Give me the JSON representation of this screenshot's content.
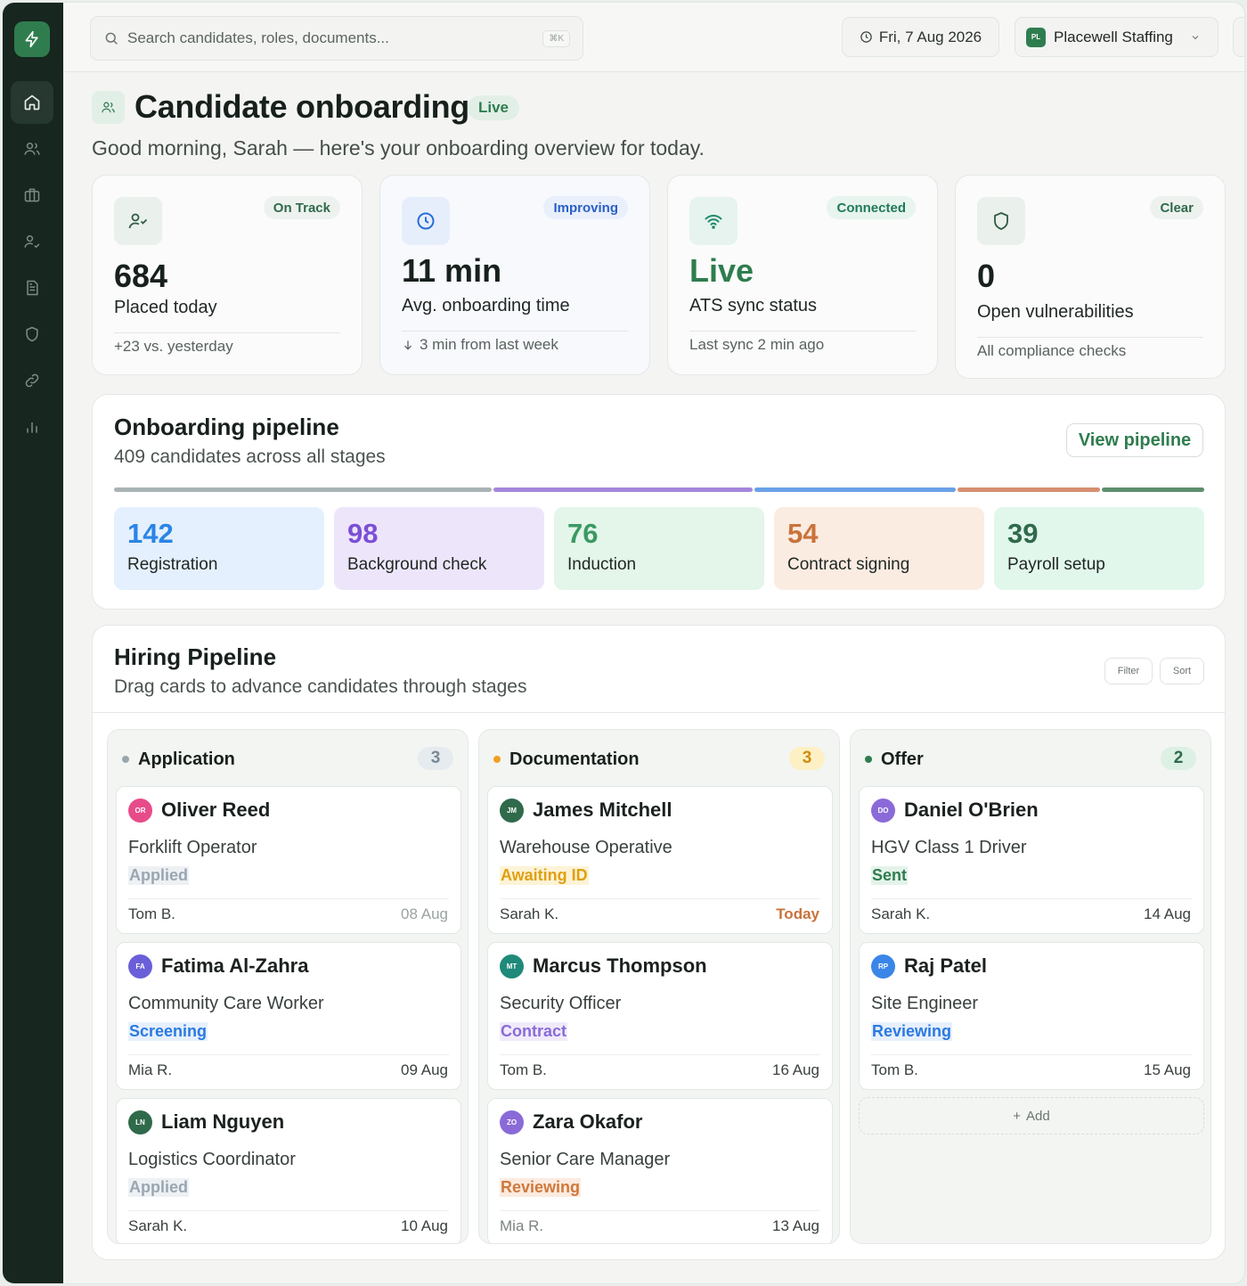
{
  "search": {
    "placeholder": "Search candidates, roles, documents...",
    "shortcut": "⌘K"
  },
  "topbar": {
    "date": "Fri, 7 Aug 2026",
    "org_initials": "PL",
    "org_name": "Placewell Staffing"
  },
  "header": {
    "title": "Candidate onboarding",
    "status_badge": "Live",
    "greeting": "Good morning, Sarah — here's your onboarding overview for today."
  },
  "stats": [
    {
      "badge": "On Track",
      "value": "684",
      "label": "Placed today",
      "foot": "+23 vs. yesterday",
      "icon": "user-check-icon"
    },
    {
      "badge": "Improving",
      "value": "11 min",
      "label": "Avg. onboarding time",
      "foot": "3 min from last week",
      "icon": "clock-icon"
    },
    {
      "badge": "Connected",
      "value": "Live",
      "label": "ATS sync status",
      "foot": "Last sync 2 min ago",
      "icon": "wifi-icon"
    },
    {
      "badge": "Clear",
      "value": "0",
      "label": "Open vulnerabilities",
      "foot": "All compliance checks",
      "icon": "shield-icon"
    }
  ],
  "onboarding_pipeline": {
    "title": "Onboarding pipeline",
    "subtitle": "409 candidates across all stages",
    "view_button": "View pipeline",
    "stages": [
      {
        "count": "142",
        "label": "Registration",
        "color": "#2a85e6"
      },
      {
        "count": "98",
        "label": "Background check",
        "color": "#7b4fd6"
      },
      {
        "count": "76",
        "label": "Induction",
        "color": "#3a9a63"
      },
      {
        "count": "54",
        "label": "Contract signing",
        "color": "#c9733a"
      },
      {
        "count": "39",
        "label": "Payroll setup",
        "color": "#2f6a4a"
      }
    ]
  },
  "hiring_pipeline": {
    "title": "Hiring Pipeline",
    "subtitle": "Drag cards to advance candidates through stages",
    "filter_button": "Filter",
    "sort_button": "Sort",
    "add_label": "Add",
    "columns": [
      {
        "title": "Application",
        "count": "3",
        "cards": [
          {
            "initials": "OR",
            "name": "Oliver Reed",
            "role": "Forklift Operator",
            "status": "Applied",
            "owner": "Tom B.",
            "date": "08 Aug"
          },
          {
            "initials": "FA",
            "name": "Fatima Al-Zahra",
            "role": "Community Care Worker",
            "status": "Screening",
            "owner": "Mia R.",
            "date": "09 Aug"
          },
          {
            "initials": "LN",
            "name": "Liam Nguyen",
            "role": "Logistics Coordinator",
            "status": "Applied",
            "owner": "Sarah K.",
            "date": "10 Aug"
          }
        ]
      },
      {
        "title": "Documentation",
        "count": "3",
        "cards": [
          {
            "initials": "JM",
            "name": "James Mitchell",
            "role": "Warehouse Operative",
            "status": "Awaiting ID",
            "owner": "Sarah K.",
            "date": "Today"
          },
          {
            "initials": "MT",
            "name": "Marcus Thompson",
            "role": "Security Officer",
            "status": "Contract",
            "owner": "Tom B.",
            "date": "16 Aug"
          },
          {
            "initials": "ZO",
            "name": "Zara Okafor",
            "role": "Senior Care Manager",
            "status": "Reviewing",
            "owner": "Mia R.",
            "date": "13 Aug"
          }
        ]
      },
      {
        "title": "Offer",
        "count": "2",
        "cards": [
          {
            "initials": "DO",
            "name": "Daniel O'Brien",
            "role": "HGV Class 1 Driver",
            "status": "Sent",
            "owner": "Sarah K.",
            "date": "14 Aug"
          },
          {
            "initials": "RP",
            "name": "Raj Patel",
            "role": "Site Engineer",
            "status": "Reviewing",
            "owner": "Tom B.",
            "date": "15 Aug"
          }
        ]
      }
    ]
  }
}
